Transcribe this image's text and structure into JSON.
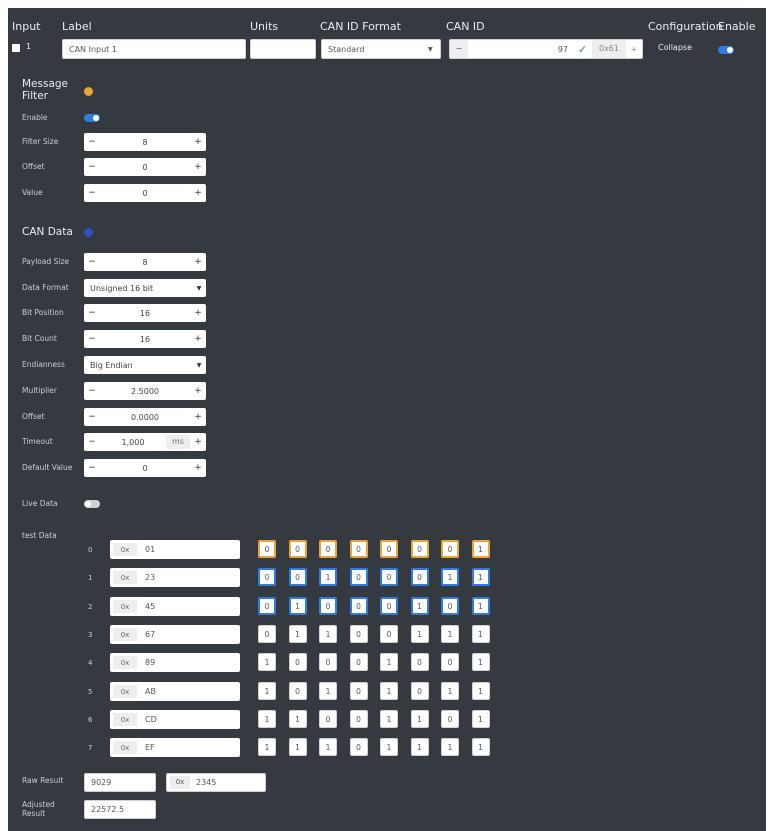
{
  "header": {
    "input": "Input",
    "label": "Label",
    "units": "Units",
    "can_id_format": "CAN ID Format",
    "can_id": "CAN ID",
    "configuration": "Configuration",
    "enable": "Enable"
  },
  "row": {
    "input_number": "1",
    "label_value": "CAN Input 1",
    "units_value": "",
    "format_value": "Standard",
    "can_id_minus": "−",
    "can_id_value": "97",
    "hex_value": "0x61",
    "hex_plus": "+",
    "collapse_label": "Collapse"
  },
  "message_filter": {
    "title": "Message Filter",
    "enable_label": "Enable",
    "filter_size_label": "Filter Size",
    "filter_size_value": "8",
    "offset_label": "Offset",
    "offset_value": "0",
    "value_label": "Value",
    "value_value": "0"
  },
  "can_data": {
    "title": "CAN Data",
    "payload_size_label": "Payload Size",
    "payload_size_value": "8",
    "data_format_label": "Data Format",
    "data_format_value": "Unsigned 16 bit",
    "bit_position_label": "Bit Position",
    "bit_position_value": "16",
    "bit_count_label": "Bit Count",
    "bit_count_value": "16",
    "endianness_label": "Endianness",
    "endianness_value": "Big Endian",
    "multiplier_label": "Multiplier",
    "multiplier_value": "2.5000",
    "offset_label": "Offset",
    "offset_value": "0.0000",
    "timeout_label": "Timeout",
    "timeout_value": "1,000",
    "timeout_unit": "ms",
    "default_label": "Default Value",
    "default_value": "0"
  },
  "live_data_label": "Live Data",
  "test_data": {
    "label": "test Data",
    "prefix": "0x",
    "rows": [
      {
        "index": "0",
        "hex": "01",
        "bits": [
          "0",
          "0",
          "0",
          "0",
          "0",
          "0",
          "0",
          "1"
        ]
      },
      {
        "index": "1",
        "hex": "23",
        "bits": [
          "0",
          "0",
          "1",
          "0",
          "0",
          "0",
          "1",
          "1"
        ]
      },
      {
        "index": "2",
        "hex": "45",
        "bits": [
          "0",
          "1",
          "0",
          "0",
          "0",
          "1",
          "0",
          "1"
        ]
      },
      {
        "index": "3",
        "hex": "67",
        "bits": [
          "0",
          "1",
          "1",
          "0",
          "0",
          "1",
          "1",
          "1"
        ]
      },
      {
        "index": "4",
        "hex": "89",
        "bits": [
          "1",
          "0",
          "0",
          "0",
          "1",
          "0",
          "0",
          "1"
        ]
      },
      {
        "index": "5",
        "hex": "AB",
        "bits": [
          "1",
          "0",
          "1",
          "0",
          "1",
          "0",
          "1",
          "1"
        ]
      },
      {
        "index": "6",
        "hex": "CD",
        "bits": [
          "1",
          "1",
          "0",
          "0",
          "1",
          "1",
          "0",
          "1"
        ]
      },
      {
        "index": "7",
        "hex": "EF",
        "bits": [
          "1",
          "1",
          "1",
          "0",
          "1",
          "1",
          "1",
          "1"
        ]
      }
    ]
  },
  "raw_result": {
    "label": "Raw Result",
    "decimal": "9029",
    "prefix": "0x",
    "hex": "2345"
  },
  "adjusted_result": {
    "label": "Adjusted Result",
    "value": "22572.5"
  },
  "colors": {
    "panel": "#343a40",
    "accent_blue": "#2f7de1",
    "accent_orange": "#e8a63a",
    "check_green": "#28a745"
  }
}
